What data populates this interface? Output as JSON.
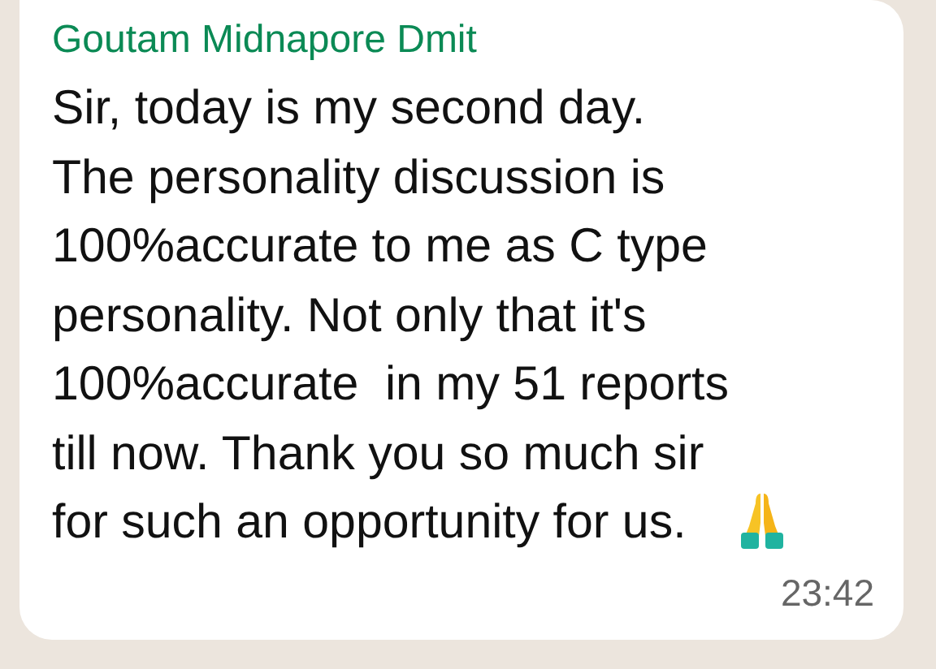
{
  "message": {
    "sender": "Goutam Midnapore Dmit",
    "text": "Sir, today is my second day.\nThe personality discussion is\n100%accurate to me as C type\npersonality. Not only that it's\n100%accurate  in my 51 reports\ntill now. Thank you so much sir\nfor such an opportunity for us.",
    "time": "23:42"
  }
}
